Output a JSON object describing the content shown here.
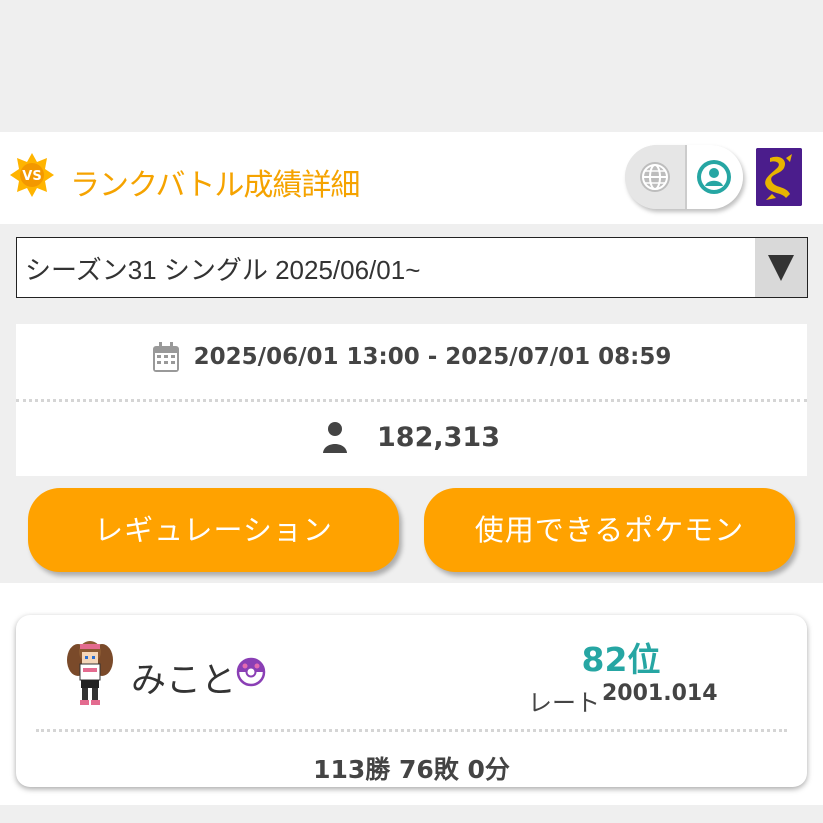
{
  "header": {
    "badge_text": "VS",
    "title": "ランクバトル成績詳細",
    "icons": [
      "globe-icon",
      "person-icon",
      "emblem-icon"
    ]
  },
  "season_select": {
    "selected": "シーズン31 シングル 2025/06/01~"
  },
  "season_info": {
    "period": "2025/06/01 13:00 - 2025/07/01 08:59",
    "players": "182,313"
  },
  "buttons": {
    "regulation": "レギュレーション",
    "usable_pokemon": "使用できるポケモン"
  },
  "player": {
    "name": "みこと",
    "rank": "82位",
    "rate_label": "レート",
    "rate_value": "2001.014",
    "record": "113勝 76敗 0分"
  },
  "colors": {
    "accent": "#ffa200",
    "title": "#f5a300",
    "rank": "#26a6a3",
    "emblem_bg": "#4b1d8c"
  }
}
